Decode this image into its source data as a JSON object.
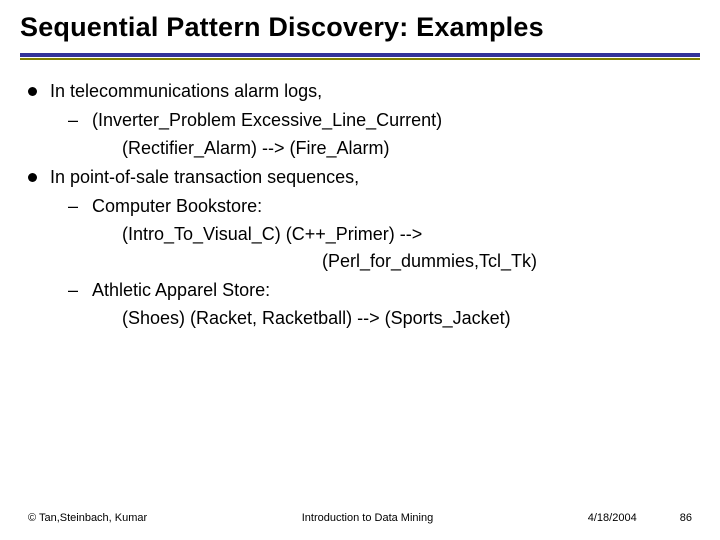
{
  "title": "Sequential Pattern Discovery: Examples",
  "bullets": [
    {
      "text": "In telecommunications alarm logs,",
      "sub": [
        {
          "text": "(Inverter_Problem  Excessive_Line_Current)",
          "details": [
            "(Rectifier_Alarm) --> (Fire_Alarm)"
          ]
        }
      ]
    },
    {
      "text": "In point-of-sale transaction sequences,",
      "sub": [
        {
          "text": "Computer Bookstore:",
          "details": [
            "(Intro_To_Visual_C)  (C++_Primer) -->"
          ],
          "details2": [
            "(Perl_for_dummies,Tcl_Tk)"
          ]
        },
        {
          "text": "Athletic Apparel Store:",
          "details": [
            "(Shoes) (Racket, Racketball) --> (Sports_Jacket)"
          ]
        }
      ]
    }
  ],
  "footer": {
    "left": "© Tan,Steinbach, Kumar",
    "center": "Introduction to Data Mining",
    "date": "4/18/2004",
    "page": "86"
  }
}
